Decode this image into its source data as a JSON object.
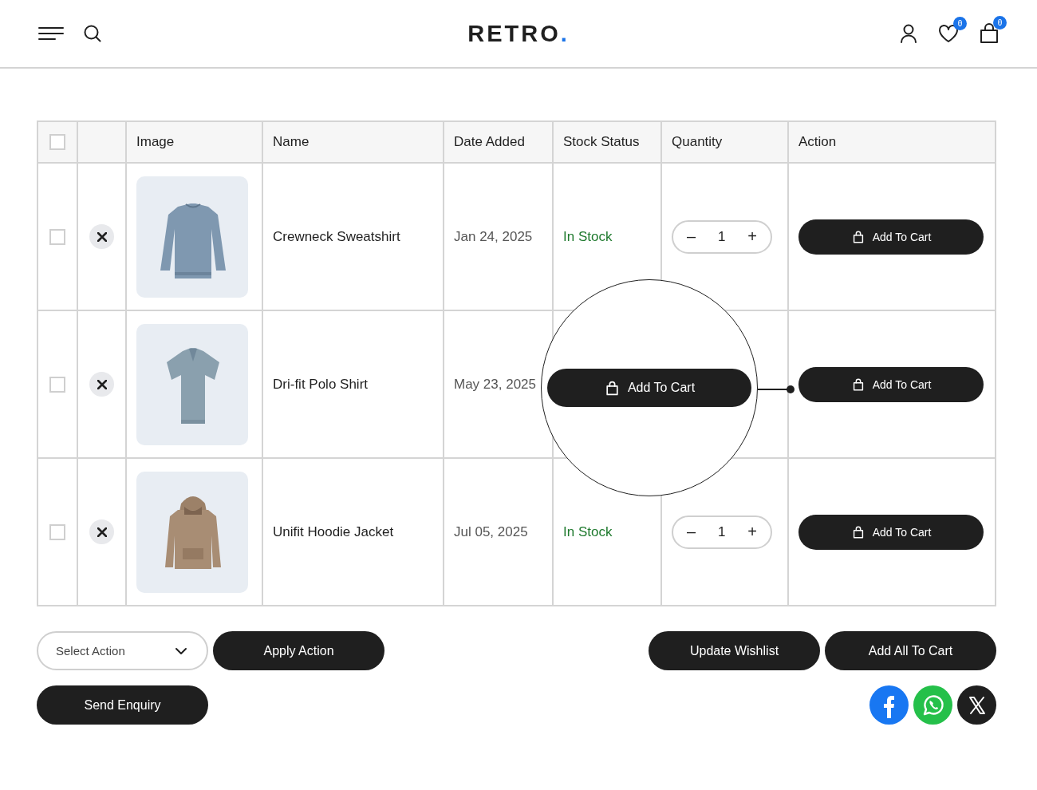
{
  "header": {
    "logo": "RETRO",
    "logo_dot": ".",
    "wishlist_count": "0",
    "cart_count": "0"
  },
  "table": {
    "columns": [
      "Image",
      "Name",
      "Date Added",
      "Stock Status",
      "Quantity",
      "Action"
    ],
    "select_all": {
      "checked": false
    },
    "rows": [
      {
        "checked": false,
        "name": "Crewneck Sweatshirt",
        "date": "Jan 24, 2025",
        "stock": "In Stock",
        "minus": "–",
        "quantity": "1",
        "plus": "+",
        "action": "Add To Cart"
      },
      {
        "checked": false,
        "name": "Dri-fit Polo Shirt",
        "date": "May 23, 2025",
        "action": "Add To Cart"
      },
      {
        "checked": false,
        "name": "Unifit Hoodie Jacket",
        "date": "Jul 05, 2025",
        "stock": "In Stock",
        "minus": "–",
        "quantity": "1",
        "plus": "+",
        "action": "Add To Cart"
      }
    ]
  },
  "magnifier": {
    "button": "Add To Cart"
  },
  "actions": {
    "select": {
      "value": "Select Action"
    },
    "apply": "Apply Action",
    "update": "Update Wishlist",
    "add_all": "Add All To Cart",
    "enquiry": "Send Enquiry"
  },
  "share": [
    {
      "kind": "facebook",
      "color": "#1877f2"
    },
    {
      "kind": "whatsapp",
      "color": "#25c04a"
    },
    {
      "kind": "x",
      "color": "#1f1f1f"
    }
  ]
}
